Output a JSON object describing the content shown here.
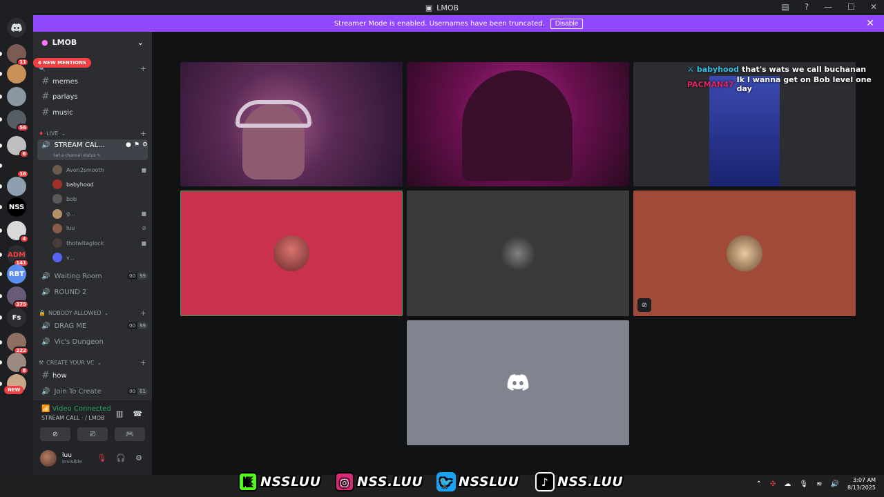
{
  "window": {
    "title": "LMOB"
  },
  "banner": {
    "text": "Streamer Mode is enabled. Usernames have been truncated.",
    "button": "Disable"
  },
  "guilds": [
    {
      "badge": "11",
      "color": "#7b5c55"
    },
    {
      "badge": "",
      "color": "#c9915a"
    },
    {
      "badge": "",
      "color": "#8a97a3"
    },
    {
      "badge": "56",
      "color": "#575d64"
    },
    {
      "badge": "6",
      "color": "#bfbfbf"
    },
    {
      "badge": "16",
      "color": "#1f1f1f"
    },
    {
      "badge": "",
      "color": "#8ea0b0"
    },
    {
      "badge": "",
      "color": "#000000",
      "label": "NSS"
    },
    {
      "badge": "4",
      "color": "#d9d9d9"
    },
    {
      "badge": "141",
      "color": "#2b2d31",
      "label": "ADM"
    },
    {
      "badge": "",
      "color": "#5a8dee",
      "label": "RBT"
    },
    {
      "badge": "375",
      "color": "#6a5a7a"
    },
    {
      "badge": "",
      "color": "#2b2d31",
      "label": "Fs"
    },
    {
      "badge": "222",
      "color": "#8e6f60"
    },
    {
      "badge": "8",
      "color": "#9a8a80"
    },
    {
      "badge": "",
      "color": "#c7a98a"
    }
  ],
  "sidebar": {
    "server_name": "LMOB",
    "mentions": "4 NEW MENTIONS",
    "new_badge": "NEW",
    "channels_top": [
      "memes",
      "parlays",
      "music"
    ],
    "live_category": "LIVE",
    "stream_call": "STREAM CAL...",
    "set_status": "Set a channel status",
    "voice_users": [
      {
        "name": "Avon2smooth",
        "icon": "camera-icon"
      },
      {
        "name": "babyhood",
        "icon": ""
      },
      {
        "name": "bob",
        "icon": ""
      },
      {
        "name": "g...",
        "icon": "camera-icon"
      },
      {
        "name": "luu",
        "icon": "mic-muted-icon"
      },
      {
        "name": "thotwitaglock",
        "icon": "camera-icon"
      },
      {
        "name": "v...",
        "icon": ""
      }
    ],
    "waiting_room": "Waiting Room",
    "waiting_counts": [
      "00",
      "99"
    ],
    "round2": "ROUND 2",
    "nobody_category": "NOBODY ALLOWED",
    "drag_me": "DRAG ME",
    "drag_counts": [
      "00",
      "99"
    ],
    "vics": "Vic's Dungeon",
    "create_category": "CREATE YOUR VC",
    "how": "how",
    "join_create": "Join To Create",
    "join_counts": [
      "00",
      "01"
    ]
  },
  "voice_panel": {
    "status": "Video Connected",
    "channel": "STREAM CALL ·",
    "server": "/ LMOB"
  },
  "userbar": {
    "name": "luu",
    "status": "Invisible"
  },
  "chat": [
    {
      "user": "babyhood",
      "text": "that's wats we call buchanan",
      "color": "#35c0e6"
    },
    {
      "user": "PACMAN47",
      "text": "Ik I wanna get on Bob level one day",
      "color": "#e0245e"
    }
  ],
  "social": [
    {
      "icon": "K",
      "handle": "NSSLUU",
      "color": "#53fc18"
    },
    {
      "icon": "◎",
      "handle": "NSS.LUU",
      "color": "#d62976"
    },
    {
      "icon": "🐦",
      "handle": "NSSLUU",
      "color": "#1da1f2"
    },
    {
      "icon": "♪",
      "handle": "NSS.LUU",
      "color": "#000000"
    }
  ],
  "clock": {
    "time": "3:07 AM",
    "date": "8/13/2025"
  }
}
